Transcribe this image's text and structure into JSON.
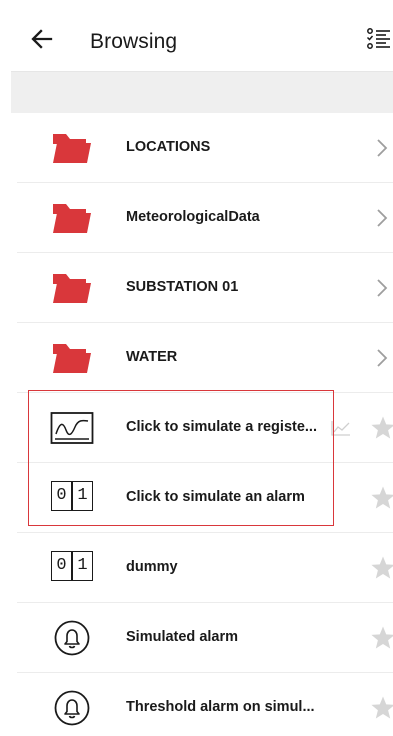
{
  "header": {
    "title": "Browsing",
    "back_icon": "arrow-left-icon",
    "list_icon": "checklist-icon"
  },
  "colors": {
    "folder": "#d9373b",
    "highlight": "#d9373b",
    "star": "#d6d6d6",
    "chevron": "#9e9e9e"
  },
  "items": [
    {
      "label": "LOCATIONS",
      "icon": "folder-icon",
      "trailing": "chevron"
    },
    {
      "label": "MeteorologicalData",
      "icon": "folder-icon",
      "trailing": "chevron"
    },
    {
      "label": "SUBSTATION 01",
      "icon": "folder-icon",
      "trailing": "chevron"
    },
    {
      "label": "WATER",
      "icon": "folder-icon",
      "trailing": "chevron"
    },
    {
      "label": "Click to simulate a registe...",
      "icon": "trend-chart-icon",
      "trailing": "star"
    },
    {
      "label": "Click to simulate an alarm",
      "icon": "binary-icon",
      "digits": [
        "0",
        "1"
      ],
      "trailing": "star"
    },
    {
      "label": "dummy",
      "icon": "binary-icon",
      "digits": [
        "0",
        "1"
      ],
      "trailing": "star"
    },
    {
      "label": "Simulated alarm",
      "icon": "bell-icon",
      "trailing": "star"
    },
    {
      "label": "Threshold alarm on simul...",
      "icon": "bell-icon",
      "trailing": "star"
    }
  ]
}
